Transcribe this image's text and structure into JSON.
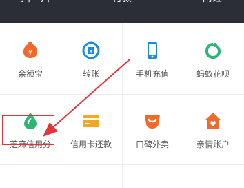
{
  "topbar": {
    "scan_label": "扫一扫",
    "pay_label": "付款",
    "nearby_label": "附近"
  },
  "grid": {
    "items": [
      {
        "label": "余额宝",
        "icon": "yuebao-icon",
        "color": "#f26a29"
      },
      {
        "label": "转账",
        "icon": "transfer-icon",
        "color": "#1b8be0"
      },
      {
        "label": "手机充值",
        "icon": "phone-recharge-icon",
        "color": "#1b8be0"
      },
      {
        "label": "蚂蚁花呗",
        "icon": "huabei-icon",
        "color": "#2bb673"
      },
      {
        "label": "芝麻信用分",
        "icon": "zhima-credit-icon",
        "color": "#2bb673"
      },
      {
        "label": "信用卡还款",
        "icon": "credit-card-repay-icon",
        "color": "#f5a623"
      },
      {
        "label": "口碑外卖",
        "icon": "koubei-takeout-icon",
        "color": "#f26a29"
      },
      {
        "label": "亲情账户",
        "icon": "family-account-icon",
        "color": "#f26a29"
      }
    ]
  },
  "annotation": {
    "highlight_color": "#e8333b",
    "arrow_color": "#e8333b"
  }
}
